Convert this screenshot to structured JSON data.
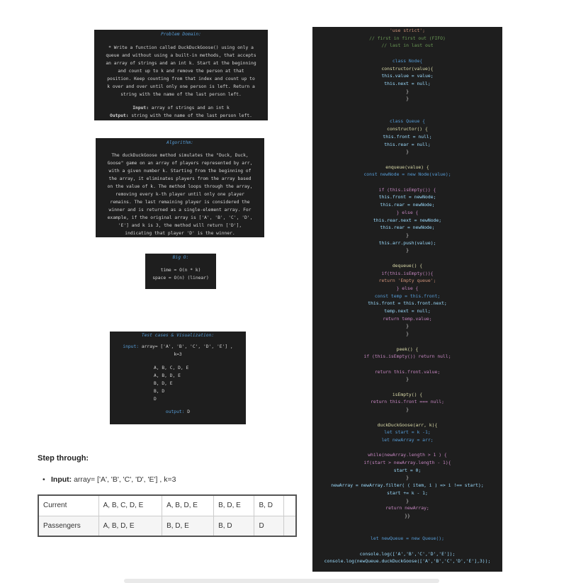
{
  "problem": {
    "title": "Problem Domain:",
    "lines": [
      "* Write a function called DuckDuckGoose() using only a",
      "queue and without using a built-in methods, that accepts",
      "an array of strings and an int k. Start at the beginning",
      "and count up to k and remove the person at that",
      "position. Keep counting from that index and count up to",
      "k over and over until only one person is left. Return a",
      "string with the name of the last person left."
    ],
    "input_label": "Input:",
    "input_text": " array of strings and an int k",
    "output_label": "Output:",
    "output_text": " string with the name of the last person left."
  },
  "algorithm": {
    "title": "Algorithm:",
    "lines": [
      "The duckDuckGoose method simulates the \"Duck, Duck,",
      "Goose\" game on an array of players represented by arr,",
      "with a given number k. Starting from the beginning of",
      "the array, it eliminates players from the array based",
      "on the value of k. The method loops through the array,",
      "removing every k-th player until only one player",
      "remains. The last remaining player is considered the",
      "winner and is returned as a single-element array. For",
      "example, if the original array is ['A', 'B', 'C', 'D',",
      "'E'] and k is 3, the method will return ['D'],",
      "indicating that player 'D' is the winner."
    ]
  },
  "bigo": {
    "title": "Big O:",
    "time": "time = O(n * k)",
    "space": "space = O(n) (linear)"
  },
  "tests": {
    "title": "Test cases & Visualization:",
    "input_label": "input:",
    "input_text": " array= ['A', 'B', 'C', 'D', 'E'] ,",
    "k_text": "k=3",
    "rows": [
      "A, B, C, D, E",
      "A, B, D, E",
      "B, D, E",
      "B, D",
      "D"
    ],
    "output_label": "output:",
    "output_value": " D"
  },
  "step": {
    "title": "Step through:",
    "input_label": "Input:",
    "input_text": " array= ['A', 'B', 'C', 'D', 'E'] , k=3"
  },
  "table": {
    "rows": [
      {
        "label": "Current",
        "cells": [
          "A, B, C, D, E",
          "A, B, D, E",
          "B, D, E",
          "B, D",
          ""
        ]
      },
      {
        "label": "Passengers",
        "cells": [
          "A, B, D, E",
          "B, D, E",
          "B, D",
          "D",
          ""
        ]
      }
    ]
  },
  "code": {
    "lines": [
      {
        "t": "'use strict';",
        "c": "str"
      },
      {
        "t": "// first in first out (FIFO)",
        "c": "comment"
      },
      {
        "t": "// last in last out",
        "c": "comment"
      },
      {
        "t": "",
        "c": "plain"
      },
      {
        "t": "class Node{",
        "c": "decl"
      },
      {
        "t": "constructor(value){",
        "c": "fn"
      },
      {
        "t": "this.value = value;",
        "c": "prop"
      },
      {
        "t": "this.next = null;",
        "c": "prop"
      },
      {
        "t": "}",
        "c": "plain"
      },
      {
        "t": "}",
        "c": "plain"
      },
      {
        "t": "",
        "c": "plain"
      },
      {
        "t": "",
        "c": "plain"
      },
      {
        "t": "class Queue {",
        "c": "decl"
      },
      {
        "t": "constructor() {",
        "c": "fn"
      },
      {
        "t": "this.front = null;",
        "c": "prop"
      },
      {
        "t": "this.rear = null;",
        "c": "prop"
      },
      {
        "t": "}",
        "c": "plain"
      },
      {
        "t": "",
        "c": "plain"
      },
      {
        "t": "enqueue(value) {",
        "c": "fn"
      },
      {
        "t": "const newNode = new Node(value);",
        "c": "decl"
      },
      {
        "t": "",
        "c": "plain"
      },
      {
        "t": "if (this.isEmpty()) {",
        "c": "kw"
      },
      {
        "t": "this.front = newNode;",
        "c": "prop"
      },
      {
        "t": "this.rear = newNode;",
        "c": "prop"
      },
      {
        "t": "} else {",
        "c": "kw"
      },
      {
        "t": "this.rear.next = newNode;",
        "c": "prop"
      },
      {
        "t": "this.rear = newNode;",
        "c": "prop"
      },
      {
        "t": "}",
        "c": "plain"
      },
      {
        "t": "this.arr.push(value);",
        "c": "prop"
      },
      {
        "t": "}",
        "c": "plain"
      },
      {
        "t": "",
        "c": "plain"
      },
      {
        "t": "dequeue() {",
        "c": "fn"
      },
      {
        "t": "if(this.isEmpty()){",
        "c": "kw"
      },
      {
        "t": "return 'Empty queue';",
        "c": "str"
      },
      {
        "t": "} else {",
        "c": "kw"
      },
      {
        "t": "const temp = this.front;",
        "c": "decl"
      },
      {
        "t": "this.front = this.front.next;",
        "c": "prop"
      },
      {
        "t": "temp.next = null;",
        "c": "prop"
      },
      {
        "t": "return temp.value;",
        "c": "kw"
      },
      {
        "t": "}",
        "c": "plain"
      },
      {
        "t": "}",
        "c": "plain"
      },
      {
        "t": "",
        "c": "plain"
      },
      {
        "t": "peek() {",
        "c": "fn"
      },
      {
        "t": "if (this.isEmpty()) return null;",
        "c": "kw"
      },
      {
        "t": "",
        "c": "plain"
      },
      {
        "t": "return this.front.value;",
        "c": "kw"
      },
      {
        "t": "}",
        "c": "plain"
      },
      {
        "t": "",
        "c": "plain"
      },
      {
        "t": "isEmpty() {",
        "c": "fn"
      },
      {
        "t": "return this.front === null;",
        "c": "kw"
      },
      {
        "t": "}",
        "c": "plain"
      },
      {
        "t": "",
        "c": "plain"
      },
      {
        "t": "duckDuckGoose(arr, k){",
        "c": "fn"
      },
      {
        "t": "let start = k -1;",
        "c": "decl"
      },
      {
        "t": "let newArray = arr;",
        "c": "decl"
      },
      {
        "t": "",
        "c": "plain"
      },
      {
        "t": "while(newArray.length > 1 ) {",
        "c": "kw"
      },
      {
        "t": "if(start > newArray.length - 1){",
        "c": "kw"
      },
      {
        "t": "start = 0;",
        "c": "prop"
      },
      {
        "t": "}",
        "c": "plain"
      },
      {
        "t": "newArray = newArray.filter( ( item, i ) => i !== start);",
        "c": "prop"
      },
      {
        "t": "start += k - 1;",
        "c": "prop"
      },
      {
        "t": "}",
        "c": "plain"
      },
      {
        "t": "return newArray;",
        "c": "kw"
      },
      {
        "t": "}}",
        "c": "plain"
      },
      {
        "t": "",
        "c": "plain"
      },
      {
        "t": "",
        "c": "plain"
      },
      {
        "t": "let newQueue = new Queue();",
        "c": "decl"
      },
      {
        "t": "",
        "c": "plain"
      },
      {
        "t": "console.log(['A','B','C','D','E']);",
        "c": "prop"
      },
      {
        "t": "console.log(newQueue.duckDuckGoose(['A','B','C','D','E'],3));",
        "c": "prop"
      }
    ]
  },
  "colors": {
    "panel_bg": "#1e1e1e",
    "title_blue": "#569cd6",
    "text": "#d4d4d4"
  }
}
